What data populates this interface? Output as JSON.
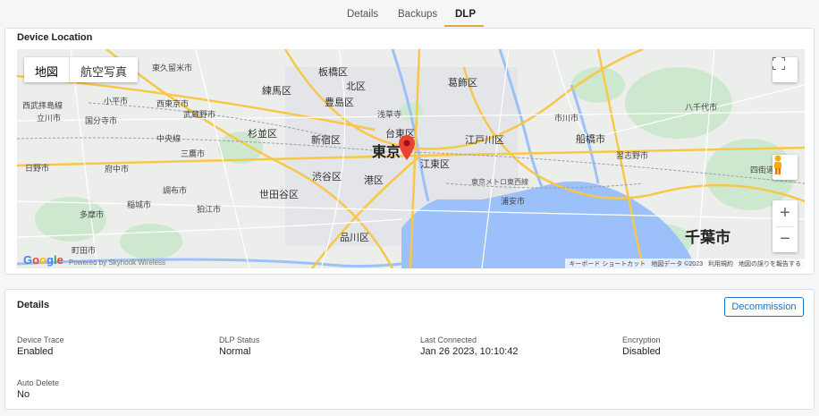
{
  "tabs": [
    {
      "label": "Details"
    },
    {
      "label": "Backups"
    },
    {
      "label": "DLP"
    }
  ],
  "active_tab": "DLP",
  "location": {
    "title": "Device Location",
    "map": {
      "type_buttons": [
        "地図",
        "航空写真"
      ],
      "selected_type": "地図",
      "labels": [
        "東京",
        "板橋区",
        "北区",
        "葛飾区",
        "練馬区",
        "豊島区",
        "台東区",
        "杉並区",
        "新宿区",
        "江戸川区",
        "江東区",
        "渋谷区",
        "港区",
        "世田谷区",
        "品川区",
        "千葉市",
        "船橋市",
        "市川市",
        "八千代市",
        "浦安市",
        "習志野市",
        "四街道",
        "稲城市",
        "多摩市",
        "府中市",
        "調布市",
        "三鷹市",
        "狛江市",
        "日野市",
        "国分寺市",
        "立川市",
        "小平市",
        "西東京市",
        "東久留米市",
        "武蔵野市",
        "中央線",
        "西武拝島線",
        "町田市",
        "東京メトロ東西線",
        "浅草寺"
      ],
      "google_logo": "Google",
      "powered_by": "Powered by Skyhook Wireless",
      "attribution": [
        "キーボード ショートカット",
        "地図データ ©2023",
        "利用規約",
        "地図の誤りを報告する"
      ]
    }
  },
  "details": {
    "title": "Details",
    "decommission_label": "Decommission",
    "fields": [
      {
        "label": "Device Trace",
        "value": "Enabled"
      },
      {
        "label": "DLP Status",
        "value": "Normal"
      },
      {
        "label": "Last Connected",
        "value": "Jan 26 2023, 10:10:42"
      },
      {
        "label": "Encryption",
        "value": "Disabled"
      },
      {
        "label": "Auto Delete",
        "value": "No"
      }
    ]
  },
  "colors": {
    "accent": "#e8a33d",
    "link": "#1a73c8",
    "marker": "#ea4335",
    "water": "#9cc0f9",
    "park": "#c8e6c9",
    "road": "#fdd663"
  }
}
